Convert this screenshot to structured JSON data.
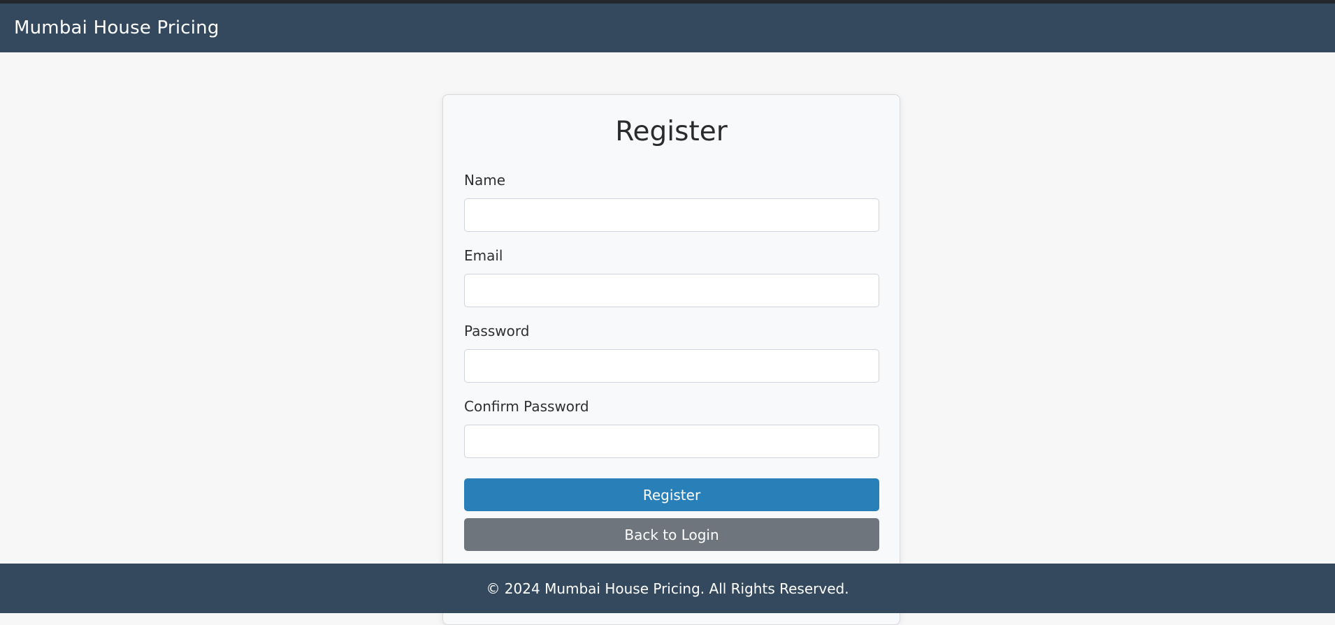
{
  "navbar": {
    "brand": "Mumbai House Pricing"
  },
  "form": {
    "title": "Register",
    "fields": [
      {
        "label": "Name",
        "value": ""
      },
      {
        "label": "Email",
        "value": ""
      },
      {
        "label": "Password",
        "value": ""
      },
      {
        "label": "Confirm Password",
        "value": ""
      }
    ],
    "register_label": "Register",
    "back_label": "Back to Login"
  },
  "footer": {
    "text": "© 2024 Mumbai House Pricing. All Rights Reserved."
  },
  "colors": {
    "navbar": "#34495e",
    "primary": "#2980b9",
    "secondary": "#6e757d",
    "background": "#f7f7f7"
  }
}
